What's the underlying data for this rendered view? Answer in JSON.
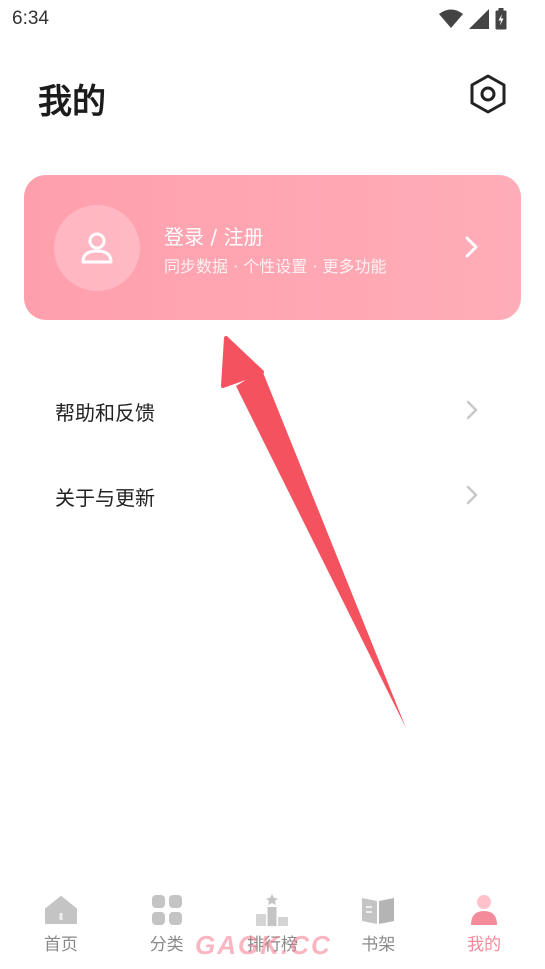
{
  "status_bar": {
    "time": "6:34",
    "icons": [
      "wifi-icon",
      "signal-icon",
      "battery-icon"
    ]
  },
  "header": {
    "title": "我的",
    "settings_icon": "settings-icon"
  },
  "login_card": {
    "title": "登录 / 注册",
    "subtitle": "同步数据 · 个性设置 · 更多功能",
    "avatar_icon": "user-icon",
    "gradient": [
      "#ff9fad",
      "#ffadb8"
    ]
  },
  "menu": {
    "items": [
      {
        "label": "帮助和反馈"
      },
      {
        "label": "关于与更新"
      }
    ]
  },
  "bottom_nav": {
    "items": [
      {
        "label": "首页",
        "icon": "home-icon",
        "active": false
      },
      {
        "label": "分类",
        "icon": "category-icon",
        "active": false
      },
      {
        "label": "排行榜",
        "icon": "ranking-icon",
        "active": false
      },
      {
        "label": "书架",
        "icon": "bookshelf-icon",
        "active": false
      },
      {
        "label": "我的",
        "icon": "profile-icon",
        "active": true
      }
    ]
  },
  "watermark": "GAGK.CC",
  "colors": {
    "accent": "#f48b9b",
    "annotation_arrow": "#f4525e",
    "inactive_nav": "#c4c4c4"
  }
}
